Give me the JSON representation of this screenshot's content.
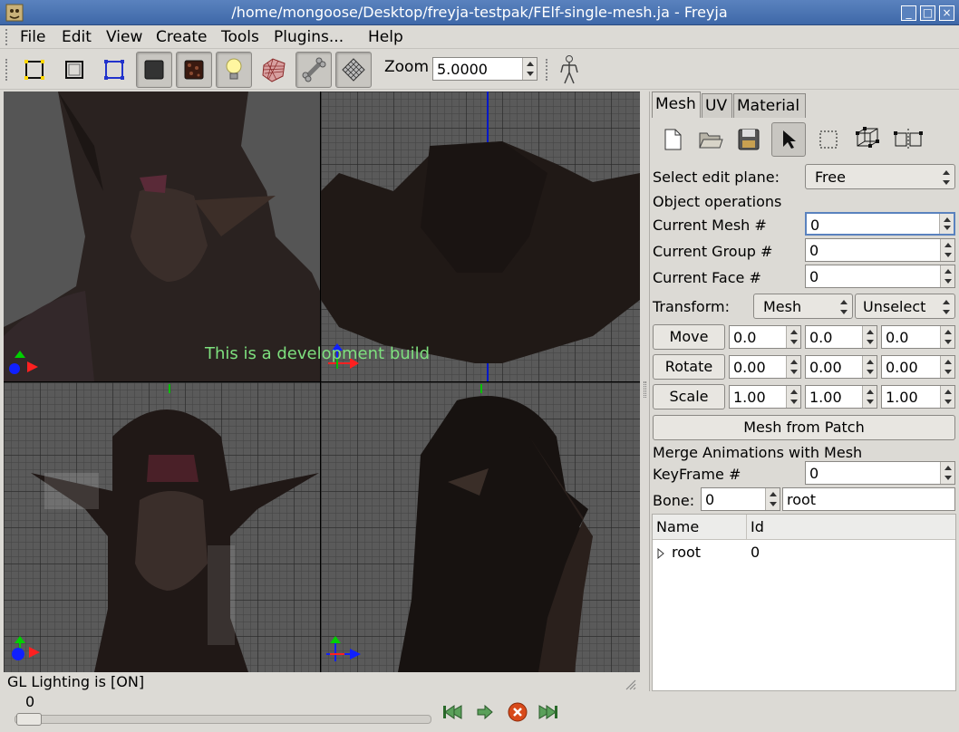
{
  "window": {
    "title": "/home/mongoose/Desktop/freyja-testpak/FElf-single-mesh.ja - Freyja",
    "minimize": "_",
    "maximize": "□",
    "close": "×"
  },
  "menubar": {
    "items": [
      {
        "label": "File"
      },
      {
        "label": "Edit"
      },
      {
        "label": "View"
      },
      {
        "label": "Create"
      },
      {
        "label": "Tools"
      },
      {
        "label": "Plugins..."
      },
      {
        "label": "Help"
      }
    ]
  },
  "toolbar": {
    "buttons": [
      {
        "icon": "select-vertex-frame-icon"
      },
      {
        "icon": "select-frame-icon"
      },
      {
        "icon": "select-edge-frame-icon"
      },
      {
        "icon": "solid-shading-icon",
        "pressed": true
      },
      {
        "icon": "texture-shading-icon",
        "pressed": true
      },
      {
        "icon": "lighting-bulb-icon",
        "pressed": true
      },
      {
        "icon": "mesh-wireframe-icon"
      },
      {
        "icon": "bone-icon",
        "pressed": true
      },
      {
        "icon": "grid-icon",
        "pressed": true
      }
    ],
    "zoom_label": "Zoom",
    "zoom_value": "5.0000",
    "skeleton_icon": "skeleton-figure-icon"
  },
  "viewport": {
    "watermark": "This is a development build"
  },
  "status": {
    "text": "GL Lighting is [ON]"
  },
  "panel": {
    "tabs": [
      {
        "label": "Mesh",
        "active": true
      },
      {
        "label": "UV"
      },
      {
        "label": "Material"
      }
    ],
    "edit_plane_label": "Select edit plane:",
    "edit_plane_value": "Free",
    "object_ops_label": "Object operations",
    "current_mesh_label": "Current Mesh  #",
    "current_mesh_value": "0",
    "current_group_label": "Current Group #",
    "current_group_value": "0",
    "current_face_label": "Current Face #",
    "current_face_value": "0",
    "transform_label": "Transform:",
    "transform_mode": "Mesh",
    "transform_select": "Unselect",
    "move_label": "Move",
    "move_values": [
      "0.0",
      "0.0",
      "0.0"
    ],
    "rotate_label": "Rotate",
    "rotate_values": [
      "0.00",
      "0.00",
      "0.00"
    ],
    "scale_label": "Scale",
    "scale_values": [
      "1.00",
      "1.00",
      "1.00"
    ],
    "mesh_from_patch": "Mesh from Patch",
    "merge_label": "Merge Animations with Mesh",
    "keyframe_label": "KeyFrame #",
    "keyframe_value": "0",
    "bone_label": "Bone:",
    "bone_value": "0",
    "bone_name": "root",
    "tree_headers": [
      "Name",
      "Id"
    ],
    "tree_rows": [
      {
        "name": "root",
        "id": "0"
      }
    ]
  },
  "timeline": {
    "frame_value": "0"
  }
}
